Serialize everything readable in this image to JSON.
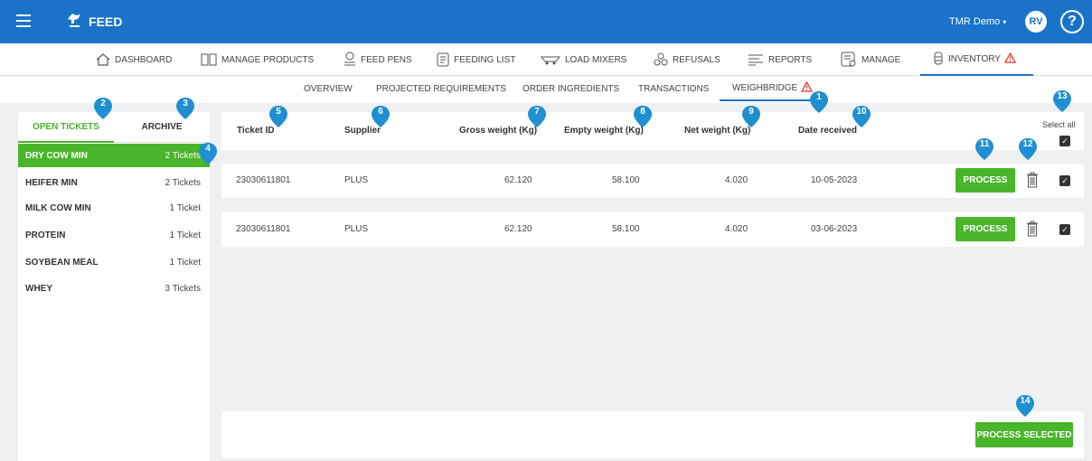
{
  "app": {
    "name": "FEED",
    "user": "TMR Demo",
    "user_caret": "▾",
    "avatar": "RV",
    "help": "?"
  },
  "main_nav": [
    {
      "label": "DASHBOARD",
      "icon": "home-icon"
    },
    {
      "label": "MANAGE PRODUCTS",
      "icon": "products-icon"
    },
    {
      "label": "FEED PENS",
      "icon": "pen-icon"
    },
    {
      "label": "FEEDING LIST",
      "icon": "list-icon"
    },
    {
      "label": "LOAD MIXERS",
      "icon": "mixer-icon"
    },
    {
      "label": "REFUSALS",
      "icon": "recycle-icon"
    },
    {
      "label": "REPORTS",
      "icon": "reports-icon"
    },
    {
      "label": "MANAGE",
      "icon": "manage-icon"
    },
    {
      "label": "INVENTORY",
      "icon": "silo-icon",
      "active": true,
      "warning": true
    }
  ],
  "sub_nav": [
    "OVERVIEW",
    "PROJECTED REQUIREMENTS",
    "ORDER INGREDIENTS",
    "TRANSACTIONS",
    "WEIGHBRIDGE"
  ],
  "sidebar": {
    "tabs": [
      "OPEN TICKETS",
      "ARCHIVE"
    ],
    "items": [
      {
        "name": "DRY COW MIN",
        "count": "2 Tickets",
        "selected": true
      },
      {
        "name": "HEIFER MIN",
        "count": "2 Tickets"
      },
      {
        "name": "MILK COW MIN",
        "count": "1 Ticket"
      },
      {
        "name": "PROTEIN",
        "count": "1 Ticket"
      },
      {
        "name": "SOYBEAN MEAL",
        "count": "1 Ticket"
      },
      {
        "name": "WHEY",
        "count": "3 Tickets"
      }
    ]
  },
  "table": {
    "columns": [
      "Ticket ID",
      "Supplier",
      "Gross weight (Kg)",
      "Empty weight (Kg)",
      "Net weight (Kg)",
      "Date received"
    ],
    "select_all": "Select all",
    "rows": [
      {
        "ticket_id": "23030611801",
        "supplier": "PLUS",
        "gross": "62.120",
        "empty": "58.100",
        "net": "4.020",
        "date": "10-05-2023"
      },
      {
        "ticket_id": "23030611801",
        "supplier": "PLUS",
        "gross": "62.120",
        "empty": "58.100",
        "net": "4.020",
        "date": "03-06-2023"
      }
    ],
    "process_label": "PROCESS",
    "process_selected_label": "PROCESS SELECTED"
  },
  "badges": [
    "1",
    "2",
    "3",
    "4",
    "5",
    "6",
    "7",
    "8",
    "9",
    "10",
    "11",
    "12",
    "13",
    "14"
  ],
  "colors": {
    "primary": "#1a73c9",
    "green": "#49b52a",
    "badge": "#1f8fd1",
    "warning": "#e53935"
  }
}
